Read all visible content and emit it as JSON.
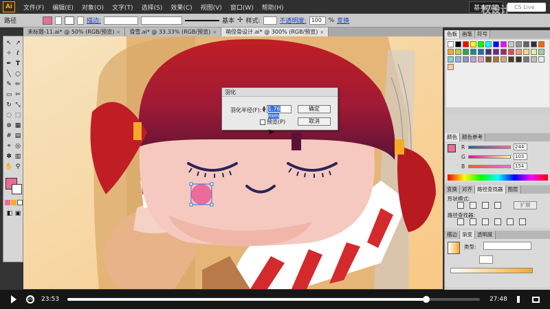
{
  "app": {
    "logo": "Ai",
    "menus": [
      "文件(F)",
      "编辑(E)",
      "对象(O)",
      "文字(T)",
      "选择(S)",
      "效果(C)",
      "视图(V)",
      "窗口(W)",
      "帮助(H)"
    ],
    "workspace": "基本功能",
    "search": "CS Live",
    "watermark": "权设计"
  },
  "control_bar": {
    "selection_label": "路径",
    "stroke_label": "描边:",
    "stroke_style": "基本",
    "style_label": "样式:",
    "opacity_label": "不透明度:",
    "opacity_value": "100",
    "opacity_unit": "%",
    "transform_label": "变换",
    "fill_color": "#ec6b98"
  },
  "doc_tabs": [
    {
      "label": "未标题-11.ai* @ 50% (RGB/预览)",
      "close": "×",
      "active": false
    },
    {
      "label": "滑雪.ai* @ 33.33% (RGB/预览)",
      "close": "×",
      "active": false
    },
    {
      "label": "萌侄骨设计.ai* @ 300% (RGB/预览)",
      "close": "×",
      "active": true
    }
  ],
  "dialog": {
    "title": "羽化",
    "radius_label": "羽化半径(F):",
    "radius_value": "1.76 mm",
    "ok_label": "确定",
    "cancel_label": "取消",
    "preview_label": "预览(P)"
  },
  "panels": {
    "swatch_tabs": [
      {
        "label": "色板",
        "active": true
      },
      {
        "label": "画笔",
        "active": false
      },
      {
        "label": "符号",
        "active": false
      }
    ],
    "color_tabs": [
      {
        "label": "颜色",
        "active": true
      },
      {
        "label": "颜色参考",
        "active": false
      }
    ],
    "color_r_label": "R",
    "color_r": "244",
    "color_g_label": "G",
    "color_g": "103",
    "color_b_label": "B",
    "color_b": "154",
    "pathfinder_tabs": [
      {
        "label": "变换",
        "active": false
      },
      {
        "label": "对齐",
        "active": false
      },
      {
        "label": "路径查找器",
        "active": true
      },
      {
        "label": "图层",
        "active": false
      }
    ],
    "shape_mode_label": "形状模式:",
    "expand_label": "扩展",
    "pathfinder_label": "路径查找器:",
    "gradient_tabs": [
      {
        "label": "描边",
        "active": false
      },
      {
        "label": "渐变",
        "active": true
      },
      {
        "label": "透明度",
        "active": false
      }
    ],
    "gradient_type_label": "类型:"
  },
  "player": {
    "current_time": "23:53",
    "total_time": "27:48",
    "progress_fraction": 0.87,
    "play_label": "play",
    "rewind_label": "10"
  },
  "colors": {
    "hair": "#b81a22",
    "hair_dark": "#5a1238",
    "skin": "#f6c9c0",
    "cheek": "#ec6b98",
    "scarf_red": "#d42a2c",
    "background": "#f9e8c5",
    "eyes": "#2a2556"
  },
  "swatches": [
    "#ffffff",
    "#000000",
    "#ff0000",
    "#ffff00",
    "#00ff00",
    "#00ffff",
    "#0000ff",
    "#ff00ff",
    "#c8c8c8",
    "#969696",
    "#646464",
    "#323232",
    "#ff6600",
    "#f7a928",
    "#b5d334",
    "#2aa84a",
    "#1a8b8b",
    "#1c6bb0",
    "#3a2f8f",
    "#6a2a8f",
    "#a8285f",
    "#e24b5a",
    "#f49a6c",
    "#fbd38c",
    "#e1ef9a",
    "#9bd39b",
    "#7fd1d1",
    "#88b6e0",
    "#8f8fd0",
    "#c79ad8",
    "#e79ac0",
    "#7a4b2a",
    "#a8763c",
    "#d0a872",
    "#5a3a1a",
    "#333333",
    "#777777",
    "#bbbbbb",
    "#eeeeee",
    "#ffcc99"
  ]
}
